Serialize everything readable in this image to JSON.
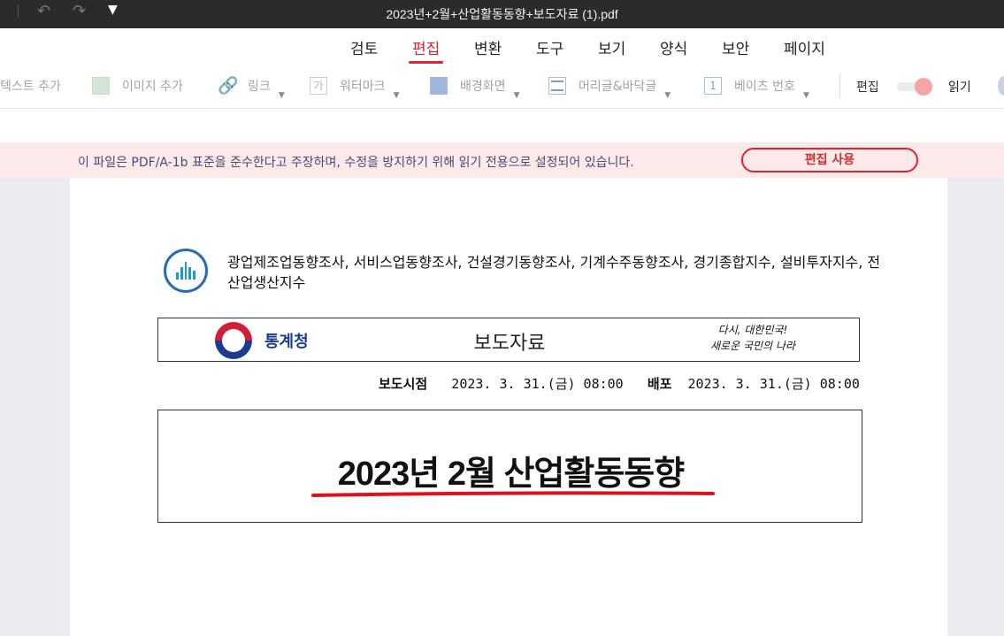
{
  "window": {
    "title": "2023년+2월+산업활동동향+보도자료 (1).pdf"
  },
  "menu": {
    "items": [
      {
        "label": "검토"
      },
      {
        "label": "편집",
        "active": true
      },
      {
        "label": "변환"
      },
      {
        "label": "도구"
      },
      {
        "label": "보기"
      },
      {
        "label": "양식"
      },
      {
        "label": "보안"
      },
      {
        "label": "페이지"
      }
    ]
  },
  "toolbar": {
    "add_text": "텍스트 추가",
    "add_image": "이미지 추가",
    "link": "링크",
    "watermark": "워터마크",
    "background": "배경화면",
    "header_footer": "머리글&바닥글",
    "bates": "베이츠 번호",
    "bates_icon_text": "1",
    "watermark_icon_text": "가",
    "edit_label": "편집",
    "read_label": "읽기",
    "mode_toggle_on": true
  },
  "notice": {
    "message": "이 파일은 PDF/A-1b 표준을 준수한다고 주장하며, 수정을 방지하기 위해 읽기 전용으로 설정되어 있습니다.",
    "button": "편집 사용"
  },
  "document": {
    "survey_list": "광업제조업동향조사, 서비스업동향조사, 건설경기동향조사, 기계수주동향조사, 경기종합지수, 설비투자지수, 전산업생산지수",
    "agency": "통계청",
    "press_release": "보도자료",
    "slogan_line1": "다시, 대한민국!",
    "slogan_line2": "새로운 국민의 나라",
    "release_label": "보도시점",
    "release_time": "2023. 3. 31.(금) 08:00",
    "distribution_label": "배포",
    "distribution_time": "2023. 3. 31.(금) 08:00",
    "main_title": "2023년 2월 산업활동동향"
  },
  "colors": {
    "accent": "#e0242f",
    "titlebar": "#2b2b2b",
    "notice_bg": "#fceaea"
  }
}
